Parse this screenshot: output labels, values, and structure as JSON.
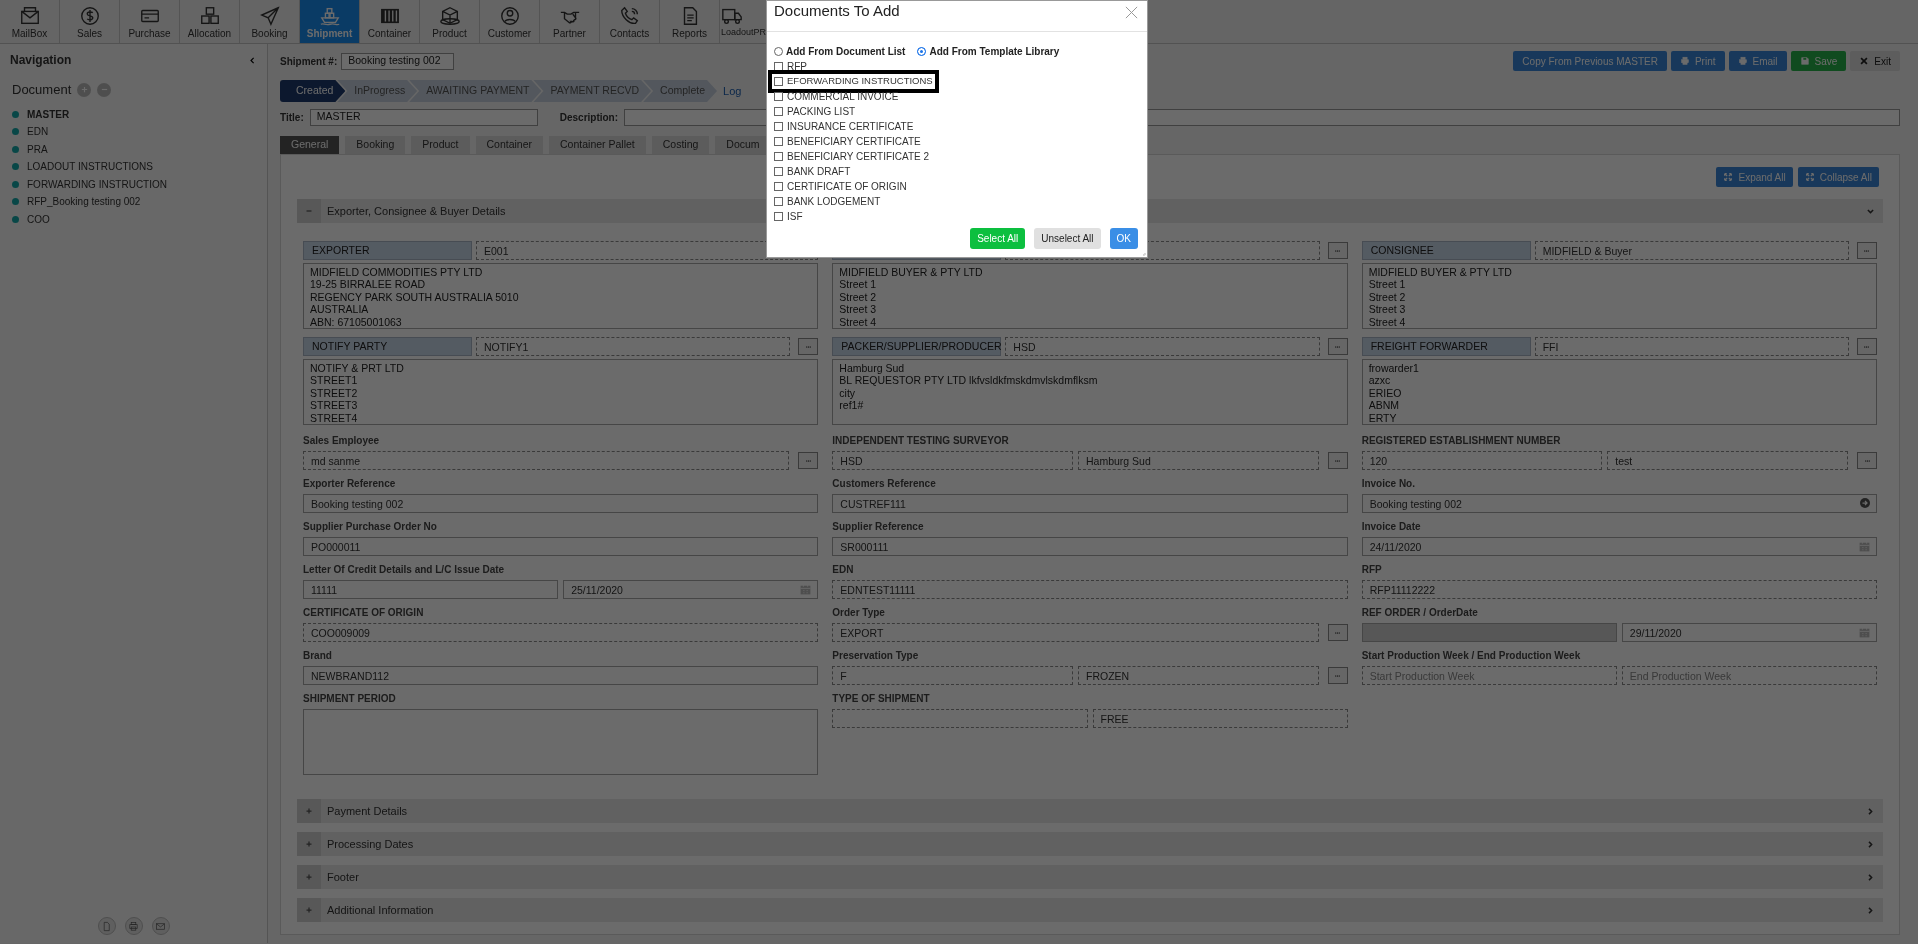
{
  "toolbar": [
    {
      "label": "MailBox",
      "selected": false
    },
    {
      "label": "Sales",
      "selected": false
    },
    {
      "label": "Purchase",
      "selected": false
    },
    {
      "label": "Allocation",
      "selected": false
    },
    {
      "label": "Booking",
      "selected": false
    },
    {
      "label": "Shipment",
      "selected": true
    },
    {
      "label": "Container",
      "selected": false
    },
    {
      "label": "Product",
      "selected": false
    },
    {
      "label": "Customer",
      "selected": false
    },
    {
      "label": "Partner",
      "selected": false
    },
    {
      "label": "Contacts",
      "selected": false
    },
    {
      "label": "Reports",
      "selected": false
    },
    {
      "label": "LoadoutPR",
      "selected": false
    }
  ],
  "navigation": {
    "title": "Navigation",
    "section": "Document",
    "items": [
      {
        "label": "MASTER",
        "selected": true
      },
      {
        "label": "EDN",
        "selected": false
      },
      {
        "label": "PRA",
        "selected": false
      },
      {
        "label": "LOADOUT INSTRUCTIONS",
        "selected": false
      },
      {
        "label": "FORWARDING INSTRUCTION",
        "selected": false
      },
      {
        "label": "RFP_Booking testing 002",
        "selected": false
      },
      {
        "label": "COO",
        "selected": false
      }
    ]
  },
  "shipment": {
    "label": "Shipment #:",
    "value": "Booking testing 002"
  },
  "actions": [
    {
      "label": "Copy From Previous MASTER",
      "kind": "copy"
    },
    {
      "label": "Print",
      "kind": "print"
    },
    {
      "label": "Email",
      "kind": "email"
    },
    {
      "label": "Save",
      "kind": "save"
    },
    {
      "label": "Exit",
      "kind": "exit"
    }
  ],
  "steps": [
    {
      "label": "Created",
      "selected": true
    },
    {
      "label": "InProgress",
      "selected": false
    },
    {
      "label": "AWAITING PAYMENT",
      "selected": false
    },
    {
      "label": "PAYMENT RECVD",
      "selected": false
    },
    {
      "label": "Complete",
      "selected": false
    }
  ],
  "log_link": "Log",
  "title_field": {
    "label": "Title:",
    "value": "MASTER"
  },
  "description_field": {
    "label": "Description:"
  },
  "tabs": [
    {
      "label": "General",
      "selected": true
    },
    {
      "label": "Booking",
      "selected": false
    },
    {
      "label": "Product",
      "selected": false
    },
    {
      "label": "Container",
      "selected": false
    },
    {
      "label": "Container Pallet",
      "selected": false
    },
    {
      "label": "Costing",
      "selected": false
    },
    {
      "label": "Docum",
      "selected": false
    }
  ],
  "panel_actions": [
    "Expand All",
    "Collapse All"
  ],
  "sections": [
    {
      "title": "Exporter, Consignee & Buyer Details",
      "expanded": true
    },
    {
      "title": "Payment Details",
      "expanded": false
    },
    {
      "title": "Processing Dates",
      "expanded": false
    },
    {
      "title": "Footer",
      "expanded": false
    },
    {
      "title": "Additional Information",
      "expanded": false
    }
  ],
  "parties": [
    [
      {
        "label": "EXPORTER",
        "code": "E001",
        "lookup": false,
        "address": [
          "MIDFIELD COMMODITIES PTY LTD",
          "19-25 BIRRALEE ROAD",
          "REGENCY PARK SOUTH AUSTRALIA 5010",
          "AUSTRALIA",
          "ABN: 67105001063"
        ]
      },
      {
        "lookup": true,
        "address": [
          "MIDFIELD BUYER  & PTY LTD",
          "Street 1",
          "Street 2",
          "Street 3",
          "Street 4"
        ]
      },
      {
        "label": "CONSIGNEE",
        "code": "MIDFIELD & Buyer",
        "lookup": true,
        "address": [
          "MIDFIELD BUYER  & PTY LTD",
          "Street 1",
          "Street 2",
          "Street 3",
          "Street 4"
        ]
      }
    ],
    [
      {
        "label": "NOTIFY PARTY",
        "code": "NOTIFY1",
        "lookup": true,
        "address": [
          "NOTIFY & PRT LTD",
          "STREET1",
          "STREET2",
          "STREET3",
          "STREET4"
        ]
      },
      {
        "label": "PACKER/SUPPLIER/PRODUCER",
        "code": "HSD",
        "lookup": true,
        "address": [
          "Hamburg Sud",
          "BL REQUESTOR PTY LTD lkfvsldkfmskdmvlskdmflksm",
          "city",
          "ref1#"
        ]
      },
      {
        "label": "FREIGHT FORWARDER",
        "code": "FFI",
        "lookup": true,
        "address": [
          "frowarder1",
          "azxc",
          "ERIEO",
          "ABNM",
          "ERTY"
        ]
      }
    ]
  ],
  "rows": [
    [
      {
        "label": "Sales Employee",
        "lookup": true,
        "inputs": [
          {
            "kind": "text",
            "value": "md sanme",
            "readonly": true,
            "disabled": false
          }
        ]
      },
      {
        "label": "INDEPENDENT TESTING SURVEYOR",
        "lookup": true,
        "inputs": [
          {
            "kind": "text",
            "value": "HSD",
            "readonly": true,
            "disabled": false
          },
          {
            "kind": "text",
            "value": "Hamburg Sud",
            "readonly": true,
            "disabled": false
          }
        ]
      },
      {
        "label": "REGISTERED ESTABLISHMENT NUMBER",
        "lookup": true,
        "inputs": [
          {
            "kind": "text",
            "value": "120",
            "readonly": true,
            "disabled": false
          },
          {
            "kind": "text",
            "value": "test",
            "readonly": true,
            "disabled": false
          }
        ]
      }
    ],
    [
      {
        "label": "Exporter Reference",
        "lookup": false,
        "inputs": [
          {
            "kind": "text",
            "value": "Booking testing 002",
            "readonly": false,
            "disabled": false
          }
        ]
      },
      {
        "label": "Customers Reference",
        "lookup": false,
        "inputs": [
          {
            "kind": "text",
            "value": "CUSTREF111",
            "readonly": false,
            "disabled": false
          }
        ]
      },
      {
        "label": "Invoice No.",
        "lookup": false,
        "inputs": [
          {
            "kind": "go",
            "value": "Booking testing 002",
            "readonly": false,
            "disabled": false
          }
        ]
      }
    ],
    [
      {
        "label": "Supplier Purchase Order No",
        "lookup": false,
        "inputs": [
          {
            "kind": "text",
            "value": "PO000011",
            "readonly": false,
            "disabled": false
          }
        ]
      },
      {
        "label": "Supplier Reference",
        "lookup": false,
        "inputs": [
          {
            "kind": "text",
            "value": "SR000111",
            "readonly": false,
            "disabled": false
          }
        ]
      },
      {
        "label": "Invoice Date",
        "lookup": false,
        "inputs": [
          {
            "kind": "date",
            "value": "24/11/2020",
            "readonly": false,
            "disabled": false
          }
        ]
      }
    ],
    [
      {
        "label": "Letter Of Credit Details and L/C Issue Date",
        "lookup": false,
        "inputs": [
          {
            "kind": "text",
            "value": "11111",
            "readonly": false,
            "disabled": false
          },
          {
            "kind": "date",
            "value": "25/11/2020",
            "readonly": false,
            "disabled": false
          }
        ]
      },
      {
        "label": "EDN",
        "lookup": false,
        "inputs": [
          {
            "kind": "text",
            "value": "EDNTEST11111",
            "readonly": true,
            "disabled": false
          }
        ]
      },
      {
        "label": "RFP",
        "lookup": false,
        "inputs": [
          {
            "kind": "text",
            "value": "RFP11112222",
            "readonly": true,
            "disabled": false
          }
        ]
      }
    ],
    [
      {
        "label": "CERTIFICATE OF ORIGIN",
        "lookup": false,
        "inputs": [
          {
            "kind": "text",
            "value": "COO009009",
            "readonly": true,
            "disabled": false
          }
        ]
      },
      {
        "label": "Order Type",
        "lookup": true,
        "inputs": [
          {
            "kind": "text",
            "value": "EXPORT",
            "readonly": true,
            "disabled": false
          }
        ]
      },
      {
        "label": "REF ORDER / OrderDate",
        "lookup": false,
        "inputs": [
          {
            "kind": "text",
            "readonly": false,
            "disabled": true
          },
          {
            "kind": "date",
            "value": "29/11/2020",
            "readonly": false,
            "disabled": false
          }
        ]
      }
    ],
    [
      {
        "label": "Brand",
        "lookup": false,
        "inputs": [
          {
            "kind": "text",
            "value": "NEWBRAND112",
            "readonly": false,
            "disabled": false
          }
        ]
      },
      {
        "label": "Preservation Type",
        "lookup": true,
        "inputs": [
          {
            "kind": "text",
            "value": "F",
            "readonly": true,
            "disabled": false
          },
          {
            "kind": "text",
            "value": "FROZEN",
            "readonly": true,
            "disabled": false
          }
        ]
      },
      {
        "label": "Start Production Week / End Production Week",
        "lookup": false,
        "inputs": [
          {
            "kind": "text",
            "placeholder": "Start Production Week",
            "readonly": true,
            "disabled": false
          },
          {
            "kind": "text",
            "placeholder": "End Production Week",
            "readonly": true,
            "disabled": false
          }
        ]
      }
    ],
    [
      {
        "label": "SHIPMENT PERIOD",
        "lookup": false,
        "inputs": [
          {
            "kind": "textarea",
            "readonly": false,
            "disabled": false
          }
        ]
      },
      {
        "label": "TYPE OF SHIPMENT",
        "lookup": false,
        "inputs": [
          {
            "kind": "text",
            "readonly": true,
            "disabled": false
          },
          {
            "kind": "text",
            "value": "FREE",
            "readonly": true,
            "disabled": false
          }
        ]
      },
      null
    ]
  ],
  "dialog": {
    "title": "Documents To Add",
    "sources": [
      {
        "label": "Add From Document List",
        "selected": false
      },
      {
        "label": "Add From Template Library",
        "selected": true
      }
    ],
    "documents": [
      {
        "label": "RFP",
        "checked": false,
        "highlighted": false
      },
      {
        "label": "EFORWARDING INSTRUCTIONS",
        "checked": false,
        "highlighted": true
      },
      {
        "label": "COMMERCIAL INVOICE",
        "checked": false,
        "highlighted": false
      },
      {
        "label": "PACKING LIST",
        "checked": false,
        "highlighted": false
      },
      {
        "label": "INSURANCE CERTIFICATE",
        "checked": false,
        "highlighted": false
      },
      {
        "label": "BENEFICIARY CERTIFICATE",
        "checked": false,
        "highlighted": false
      },
      {
        "label": "BENEFICIARY CERTIFICATE 2",
        "checked": false,
        "highlighted": false
      },
      {
        "label": "BANK DRAFT",
        "checked": false,
        "highlighted": false
      },
      {
        "label": "CERTIFICATE OF ORIGIN",
        "checked": false,
        "highlighted": false
      },
      {
        "label": "BANK LODGEMENT",
        "checked": false,
        "highlighted": false
      },
      {
        "label": "ISF",
        "checked": false,
        "highlighted": false
      }
    ],
    "buttons": [
      {
        "label": "Select All",
        "kind": "success"
      },
      {
        "label": "Unselect All",
        "kind": "secondary"
      },
      {
        "label": "OK",
        "kind": "primary"
      }
    ]
  }
}
